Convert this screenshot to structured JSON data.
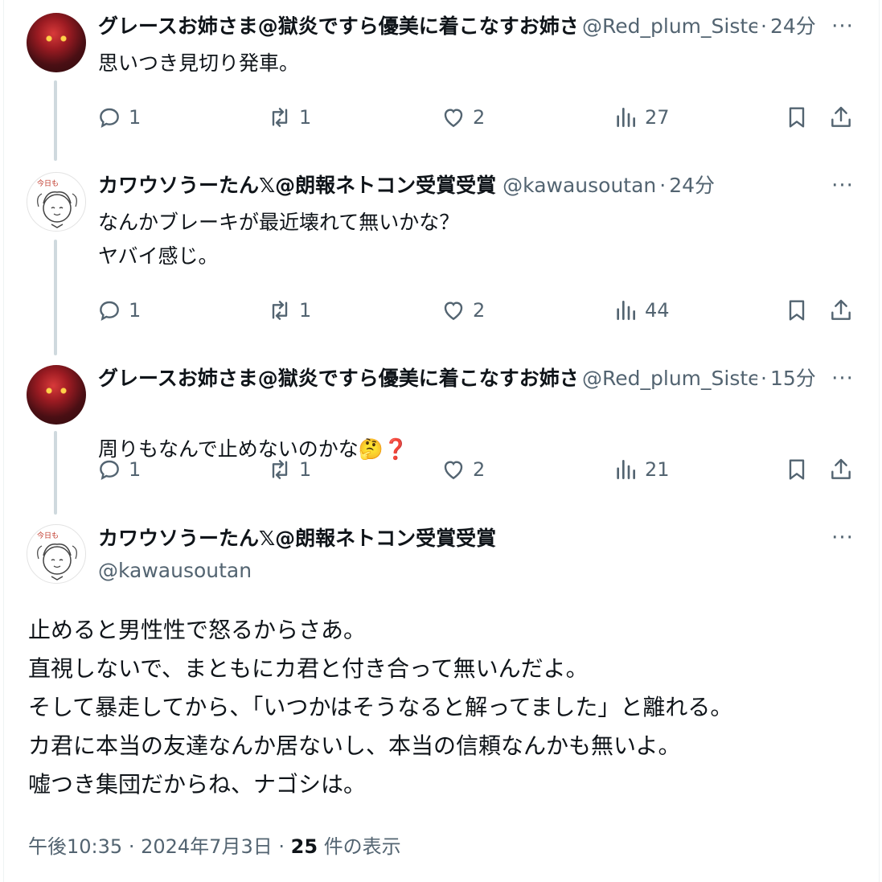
{
  "tweets": [
    {
      "display_name": "グレースお姉さま@獄炎ですら優美に着こなすお姉さま",
      "handle": "@Red_plum_Sister",
      "time": "24分",
      "body": "思いつき見切り発車。",
      "stats": {
        "reply": "1",
        "retweet": "1",
        "like": "2",
        "views": "27"
      }
    },
    {
      "display_name": "カワウソうーたん𝕏@朗報ネトコン受賞受賞",
      "handle": "@kawausoutan",
      "time": "24分",
      "body": "なんかブレーキが最近壊れて無いかな？\nヤバイ感じ。",
      "stats": {
        "reply": "1",
        "retweet": "1",
        "like": "2",
        "views": "44"
      }
    },
    {
      "display_name": "グレースお姉さま@獄炎ですら優美に着こなすお姉さま",
      "handle": "@Red_plum_Sister",
      "time": "15分",
      "body": "周りもなんで止めないのかな",
      "body_emoji": "🤔",
      "body_emoji2": "❓",
      "stats": {
        "reply": "1",
        "retweet": "1",
        "like": "2",
        "views": "21"
      }
    }
  ],
  "focus": {
    "display_name": "カワウソうーたん𝕏@朗報ネトコン受賞受賞",
    "handle": "@kawausoutan",
    "body": "止めると男性性で怒るからさあ。\n直視しないで、まともにカ君と付き合って無いんだよ。\nそして暴走してから、「いつかはそうなると解ってました」と離れる。\nカ君に本当の友達なんか居ないし、本当の信頼なんかも無いよ。\n嘘つき集団だからね、ナゴシは。",
    "time": "午後10:35",
    "date": "2024年7月3日",
    "views_count": "25",
    "views_label": "件の表示"
  },
  "ui": {
    "separator": "·",
    "more_glyph": "···"
  },
  "colors": {
    "text": "#0f1419",
    "secondary": "#536471",
    "thread_line": "#cfd9de"
  },
  "icons": [
    "reply-icon",
    "retweet-icon",
    "like-icon",
    "views-icon",
    "bookmark-icon",
    "share-icon",
    "more-icon"
  ]
}
